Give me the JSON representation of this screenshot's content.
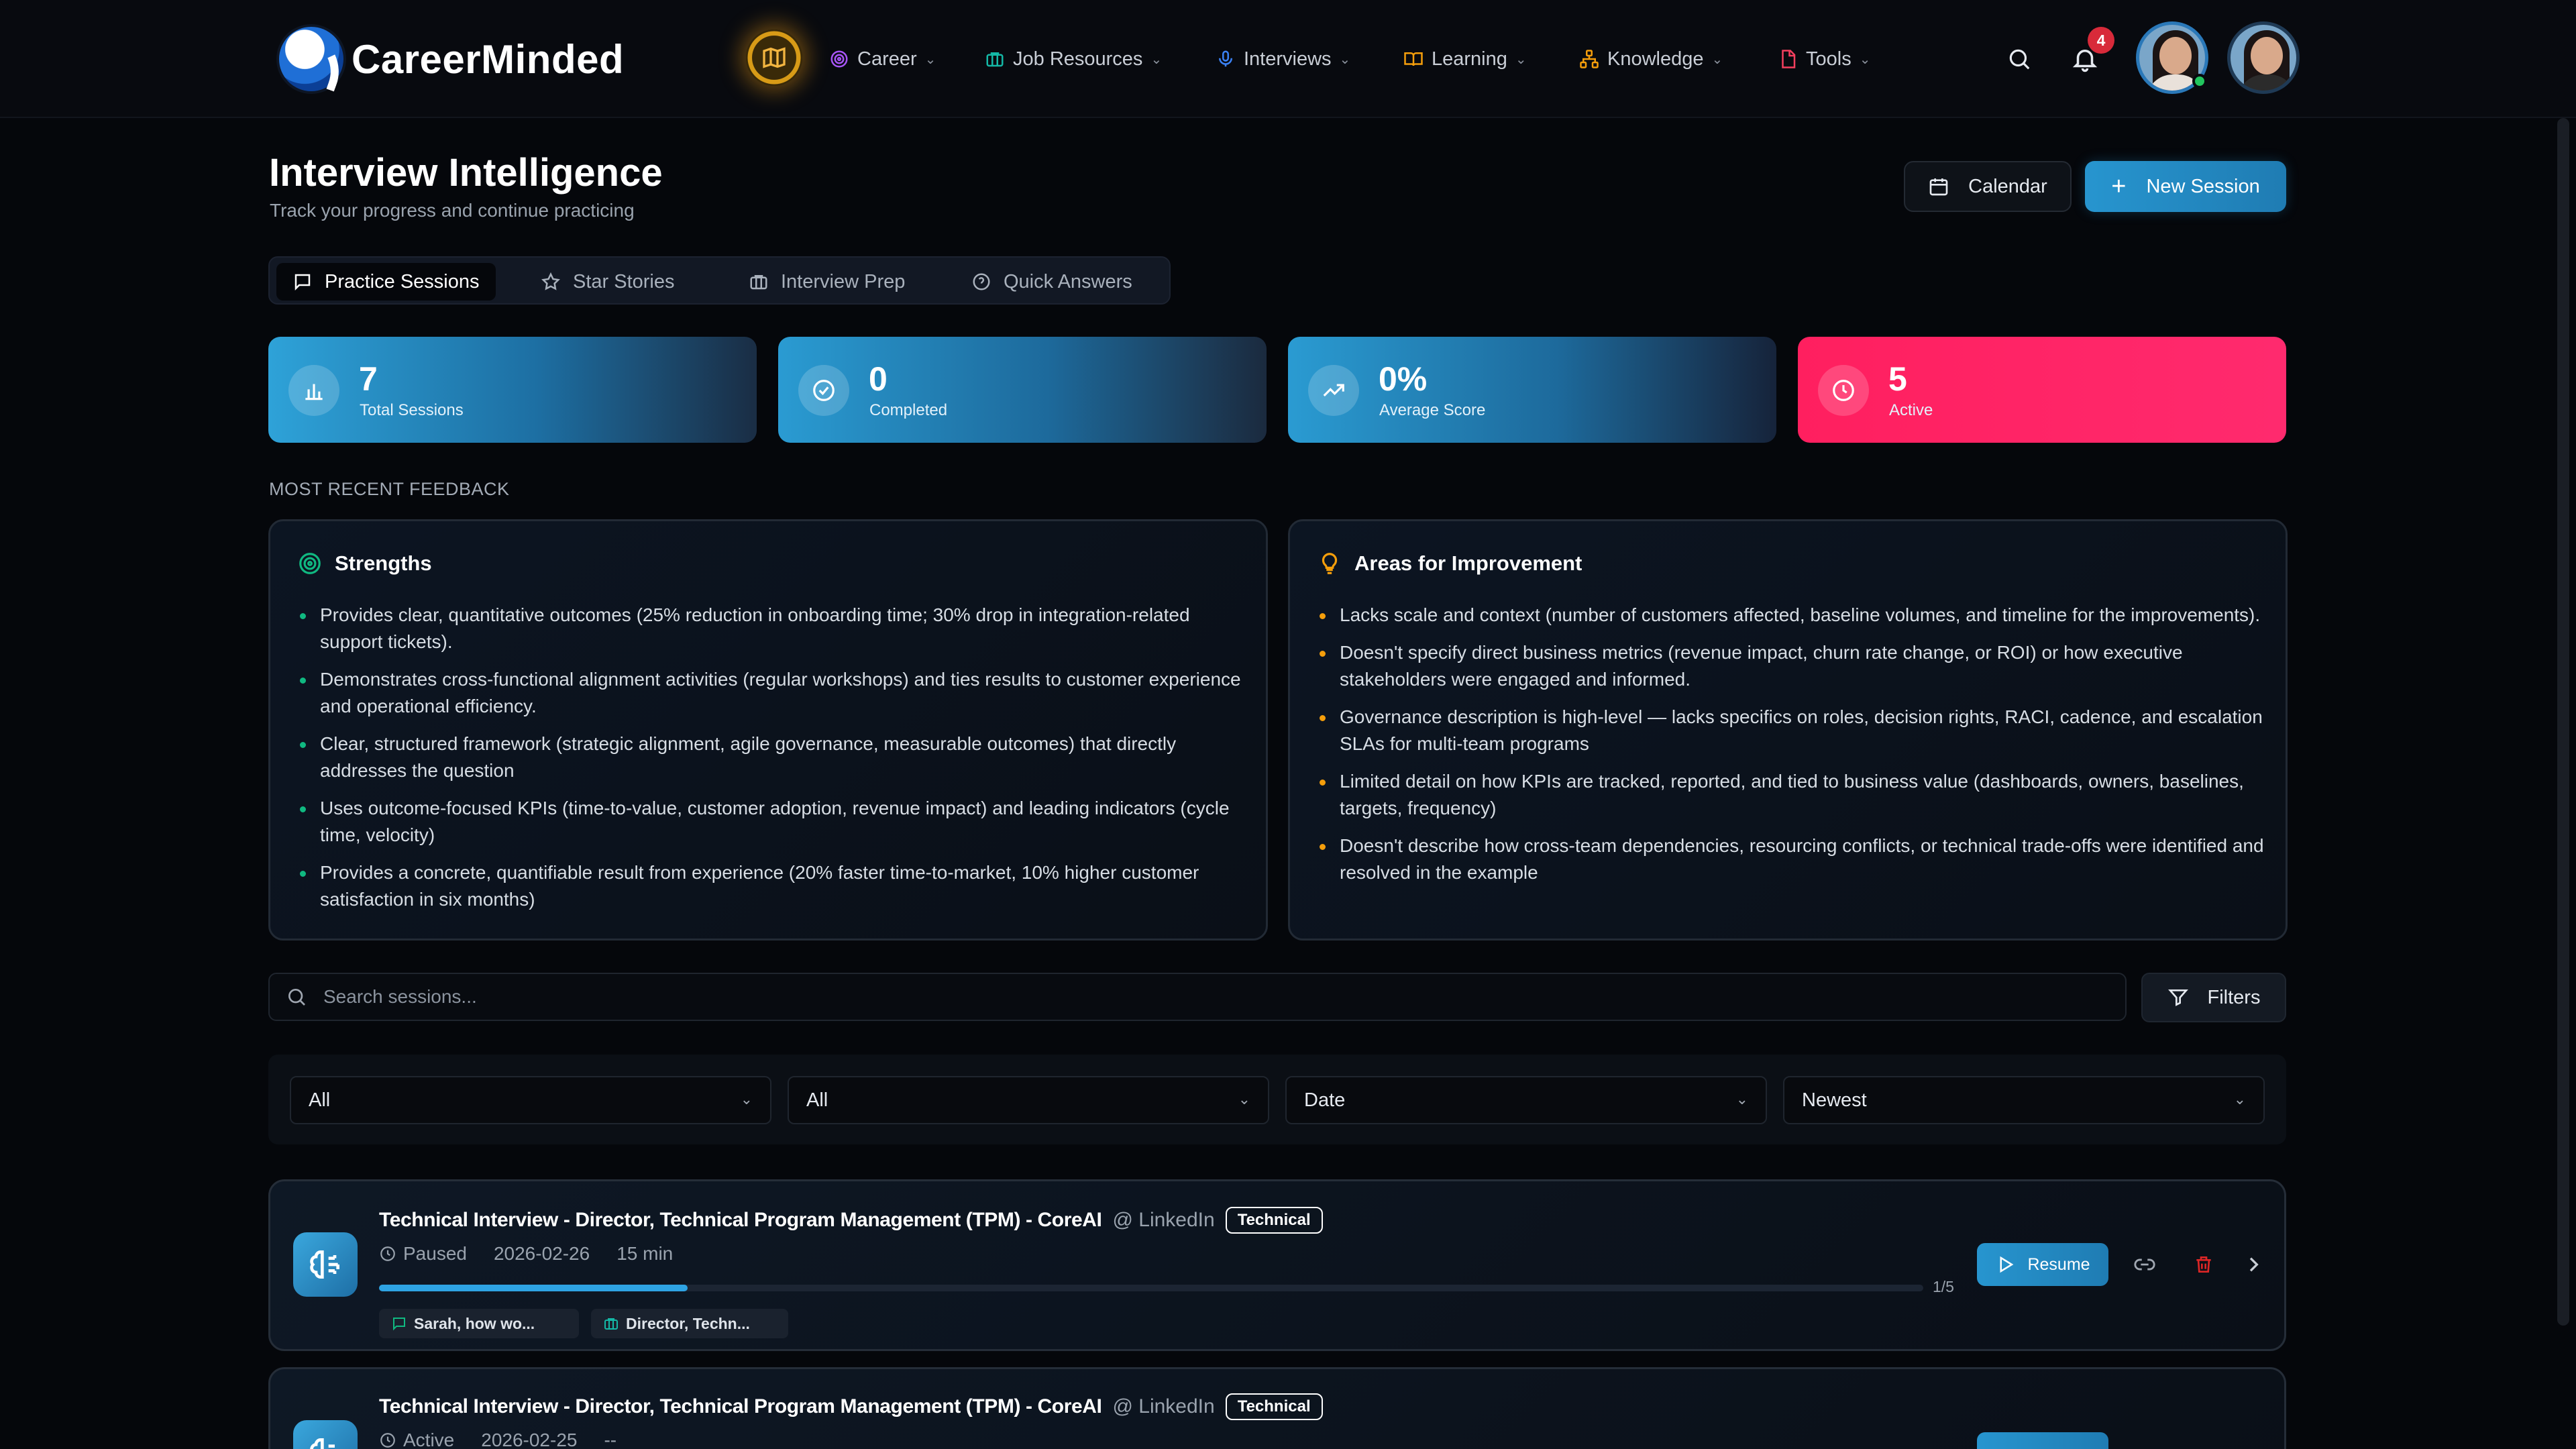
{
  "brand": {
    "name": "CareerMinded"
  },
  "nav": {
    "items": [
      {
        "label": "Career"
      },
      {
        "label": "Job Resources"
      },
      {
        "label": "Interviews"
      },
      {
        "label": "Learning"
      },
      {
        "label": "Knowledge"
      },
      {
        "label": "Tools"
      }
    ],
    "notification_count": "4"
  },
  "header": {
    "title": "Interview Intelligence",
    "subtitle": "Track your progress and continue practicing",
    "calendar_label": "Calendar",
    "new_session_label": "New Session"
  },
  "tabs": [
    {
      "label": "Practice Sessions",
      "active": true
    },
    {
      "label": "Star Stories"
    },
    {
      "label": "Interview Prep"
    },
    {
      "label": "Quick Answers"
    }
  ],
  "stats": [
    {
      "value": "7",
      "label": "Total Sessions",
      "icon": "bar-chart-icon"
    },
    {
      "value": "0",
      "label": "Completed",
      "icon": "check-circle-icon"
    },
    {
      "value": "0%",
      "label": "Average Score",
      "icon": "trending-up-icon"
    },
    {
      "value": "5",
      "label": "Active",
      "icon": "clock-icon"
    }
  ],
  "feedback": {
    "section_label": "MOST RECENT FEEDBACK",
    "strengths": {
      "title": "Strengths",
      "items": [
        "Provides clear, quantitative outcomes (25% reduction in onboarding time; 30% drop in integration-related support tickets).",
        "Demonstrates cross-functional alignment activities (regular workshops) and ties results to customer experience and operational efficiency.",
        "Clear, structured framework (strategic alignment, agile governance, measurable outcomes) that directly addresses the question",
        "Uses outcome-focused KPIs (time-to-value, customer adoption, revenue impact) and leading indicators (cycle time, velocity)",
        "Provides a concrete, quantifiable result from experience (20% faster time-to-market, 10% higher customer satisfaction in six months)"
      ]
    },
    "improvements": {
      "title": "Areas for Improvement",
      "items": [
        "Lacks scale and context (number of customers affected, baseline volumes, and timeline for the improvements).",
        "Doesn't specify direct business metrics (revenue impact, churn rate change, or ROI) or how executive stakeholders were engaged and informed.",
        "Governance description is high-level — lacks specifics on roles, decision rights, RACI, cadence, and escalation SLAs for multi-team programs",
        "Limited detail on how KPIs are tracked, reported, and tied to business value (dashboards, owners, baselines, targets, frequency)",
        "Doesn't describe how cross-team dependencies, resourcing conflicts, or technical trade-offs were identified and resolved in the example"
      ]
    }
  },
  "search": {
    "placeholder": "Search sessions...",
    "filters_label": "Filters"
  },
  "filters": [
    {
      "value": "All"
    },
    {
      "value": "All"
    },
    {
      "value": "Date"
    },
    {
      "value": "Newest"
    }
  ],
  "sessions": [
    {
      "title": "Technical Interview - Director, Technical Program Management (TPM) - CoreAI",
      "company": "@ LinkedIn",
      "tag": "Technical",
      "status": "Paused",
      "date": "2026-02-26",
      "duration": "15 min",
      "progress": 0.2,
      "progress_text": "1/5",
      "chips": [
        "Sarah, how wo...",
        "Director, Techn..."
      ],
      "resume_label": "Resume"
    },
    {
      "title": "Technical Interview - Director, Technical Program Management (TPM) - CoreAI",
      "company": "@ LinkedIn",
      "tag": "Technical",
      "status": "Active",
      "date": "2026-02-25",
      "duration": "--"
    }
  ],
  "colors": {
    "accent": "#2795cf",
    "active_card": "#ff1f66",
    "strength_bullet": "#10b981",
    "improvement_bullet": "#f59e0b"
  }
}
